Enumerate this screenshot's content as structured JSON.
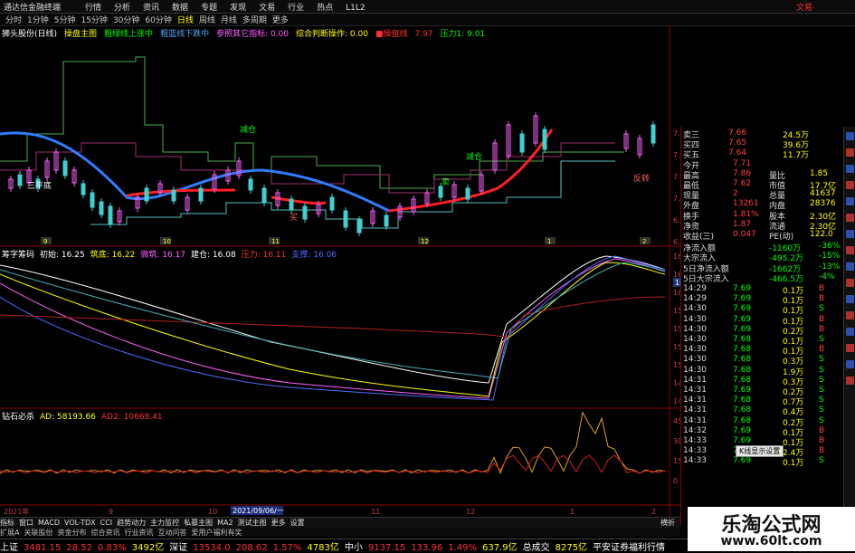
{
  "topbar": {
    "app_title": "通达信金融终端",
    "menu": [
      "行情",
      "分析",
      "资讯",
      "数据",
      "专题",
      "发现",
      "文易",
      "行业",
      "热点",
      "L1L2"
    ],
    "brand": "文易·"
  },
  "periods": {
    "items": [
      "分时",
      "1分钟",
      "5分钟",
      "15分钟",
      "30分钟",
      "60分钟",
      "日线",
      "周线",
      "月线",
      "多周期",
      "更多"
    ],
    "selected": "日线"
  },
  "main_indicators": {
    "stock": "狮头股份(日线)",
    "items": [
      {
        "text": "操盘主图",
        "color": "#ffff00"
      },
      {
        "text": "粗绿线上涨中",
        "color": "#00ff00"
      },
      {
        "text": "粗蓝线下跌中",
        "color": "#4fa8ff"
      },
      {
        "text": "参照其它指标: 0.00",
        "color": "#ff60ff"
      },
      {
        "text": "综合判断操作: 0.00",
        "color": "#ffff00"
      },
      {
        "text": "■操盘线",
        "color": "#ff3030"
      },
      {
        "text": "7.97",
        "color": "#ff3030"
      },
      {
        "text": "压力1: 9.01",
        "color": "#00ff00"
      }
    ]
  },
  "price_panel": {
    "annotations": [
      {
        "text": "三平底",
        "color": "#ffffff"
      },
      {
        "text": "减仓",
        "color": "#00ff00"
      },
      {
        "text": "减仓",
        "color": "#00ff00"
      },
      {
        "text": "买",
        "color": "#ff6060"
      },
      {
        "text": "卖",
        "color": "#00ff00"
      },
      {
        "text": "反转",
        "color": "#ff6060"
      }
    ],
    "axis": [
      "7.75",
      "7.50",
      "7.25",
      "7.00",
      "6.75",
      "6.50"
    ],
    "month_markers": [
      "9",
      "10",
      "11",
      "12",
      "1",
      "2"
    ]
  },
  "middle_panel": {
    "name": "筹字筹码",
    "legend": [
      {
        "text": "初始: 16.25",
        "color": "#ffffff"
      },
      {
        "text": "筑底: 16.22",
        "color": "#ffff00"
      },
      {
        "text": "微筑: 16.17",
        "color": "#ff60ff"
      },
      {
        "text": "建仓: 16.08",
        "color": "#ffffff"
      },
      {
        "text": "压力: 16.11",
        "color": "#ff3030"
      },
      {
        "text": "支撑: 16.06",
        "color": "#4f6bff"
      }
    ],
    "axis": [
      "16.50",
      "16.25",
      "16.00",
      "15.75",
      "15.50",
      "15.25",
      "15.00",
      "14.75",
      "14.50"
    ],
    "current": "16.00"
  },
  "bottom_panel": {
    "name": "钻石必杀",
    "legend": [
      {
        "text": "AD: 58193.66",
        "color": "#ffff00"
      },
      {
        "text": "AD2: 10668.41",
        "color": "#ff3030"
      }
    ],
    "axis": [
      "45000",
      "30000",
      "15000",
      "0"
    ]
  },
  "xaxis": {
    "start": "2021年",
    "date_box": "2021/09/06/一",
    "labels": [
      "9",
      "10",
      "11",
      "12",
      "1",
      "2"
    ]
  },
  "quote": {
    "levels": [
      {
        "name": "卖三",
        "price": "7.66",
        "vol": "24.5万"
      },
      {
        "name": "买四",
        "price": "7.65",
        "vol": "39.6万"
      },
      {
        "name": "买五",
        "price": "7.64",
        "vol": "11.7万"
      }
    ],
    "stats": [
      {
        "l": "今开",
        "v": "7.71",
        "l2": "",
        "v2": ""
      },
      {
        "l": "最高",
        "v": "7.86",
        "l2": "量比",
        "v2": "1.85"
      },
      {
        "l": "最低",
        "v": "7.62",
        "l2": "市值",
        "v2": "17.7亿"
      },
      {
        "l": "现量",
        "v": "2",
        "l2": "总量",
        "v2": "41637"
      },
      {
        "l": "外盘",
        "v": "13261",
        "l2": "内盘",
        "v2": "28376"
      },
      {
        "l": "换手",
        "v": "1.81%",
        "l2": "股本",
        "v2": "2.30亿"
      },
      {
        "l": "净资",
        "v": "1.87",
        "l2": "流通",
        "v2": "2.30亿"
      },
      {
        "l": "收益(三)",
        "v": "0.047",
        "l2": "PE(动)",
        "v2": "122.0"
      }
    ],
    "flows": [
      {
        "l": "净流入额",
        "v": "-1160万",
        "p": "-36%"
      },
      {
        "l": "大宗流入",
        "v": "-495.2万",
        "p": "-15%"
      },
      {
        "l": "5日净流入额",
        "v": "-1662万",
        "p": "-13%"
      },
      {
        "l": "5日大宗流入",
        "v": "-466.5万",
        "p": "-4%"
      }
    ],
    "ticks": [
      {
        "t": "14:29",
        "p": "7.69",
        "v": "0.1万",
        "s": "B"
      },
      {
        "t": "14:29",
        "p": "7.69",
        "v": "0.1万",
        "s": "B"
      },
      {
        "t": "14:30",
        "p": "7.69",
        "v": "0.1万",
        "s": "S"
      },
      {
        "t": "14:30",
        "p": "7.69",
        "v": "0.1万",
        "s": "B"
      },
      {
        "t": "14:30",
        "p": "7.69",
        "v": "0.2万",
        "s": "B"
      },
      {
        "t": "14:30",
        "p": "7.68",
        "v": "0.1万",
        "s": "S"
      },
      {
        "t": "14:30",
        "p": "7.68",
        "v": "0.1万",
        "s": "B"
      },
      {
        "t": "14:30",
        "p": "7.68",
        "v": "0.3万",
        "s": "S"
      },
      {
        "t": "14:30",
        "p": "7.68",
        "v": "1.9万",
        "s": "S"
      },
      {
        "t": "14:31",
        "p": "7.68",
        "v": "0.3万",
        "s": "S"
      },
      {
        "t": "14:31",
        "p": "7.69",
        "v": "0.2万",
        "s": "S"
      },
      {
        "t": "14:31",
        "p": "7.68",
        "v": "0.7万",
        "s": "S"
      },
      {
        "t": "14:31",
        "p": "7.68",
        "v": "0.4万",
        "s": "S"
      },
      {
        "t": "14:31",
        "p": "7.68",
        "v": "0.2万",
        "s": "S"
      },
      {
        "t": "14:32",
        "p": "7.69",
        "v": "0.1万",
        "s": "B"
      },
      {
        "t": "14:33",
        "p": "7.69",
        "v": "0.1万",
        "s": "B"
      },
      {
        "t": "14:33",
        "p": "7.69",
        "v": "2.4万",
        "s": "B"
      },
      {
        "t": "14:33",
        "p": "7.69",
        "v": "0.1万",
        "s": "S"
      }
    ],
    "tooltip": "K线显示设置"
  },
  "tabs": [
    "指标",
    "窗口",
    "MACD",
    "VOL-TDX",
    "CCI",
    "趋势动力",
    "主力监控",
    "私募主图",
    "MA2",
    "测试主图",
    "更多",
    "设置"
  ],
  "tabs2": [
    "扩展A",
    "关联股份",
    "资金分布",
    "综合资讯",
    "行业资讯",
    "互动问答",
    "爱用户福利有奖"
  ],
  "right_tabs": "横折",
  "status": [
    {
      "text": "上证",
      "color": "#ffffff"
    },
    {
      "text": "3481.15",
      "color": "#ff3030"
    },
    {
      "text": "28.52",
      "color": "#ff3030"
    },
    {
      "text": "0.83%",
      "color": "#ff3030"
    },
    {
      "text": "3492亿",
      "color": "#ffff00"
    },
    {
      "text": "深证",
      "color": "#ffffff"
    },
    {
      "text": "13534.0",
      "color": "#ff3030"
    },
    {
      "text": "208.62",
      "color": "#ff3030"
    },
    {
      "text": "1.57%",
      "color": "#ff3030"
    },
    {
      "text": "4783亿",
      "color": "#ffff00"
    },
    {
      "text": "中小",
      "color": "#ffffff"
    },
    {
      "text": "9137.15",
      "color": "#ff3030"
    },
    {
      "text": "133.96",
      "color": "#ff3030"
    },
    {
      "text": "1.49%",
      "color": "#ff3030"
    },
    {
      "text": "637.9亿",
      "color": "#ffff00"
    },
    {
      "text": "总成交",
      "color": "#ffffff"
    },
    {
      "text": "8275亿",
      "color": "#ffff00"
    },
    {
      "text": "平安证券福利行情",
      "color": "#ffffff"
    }
  ],
  "watermark": {
    "title": "乐淘公式网",
    "url": "www.60lt.com"
  }
}
